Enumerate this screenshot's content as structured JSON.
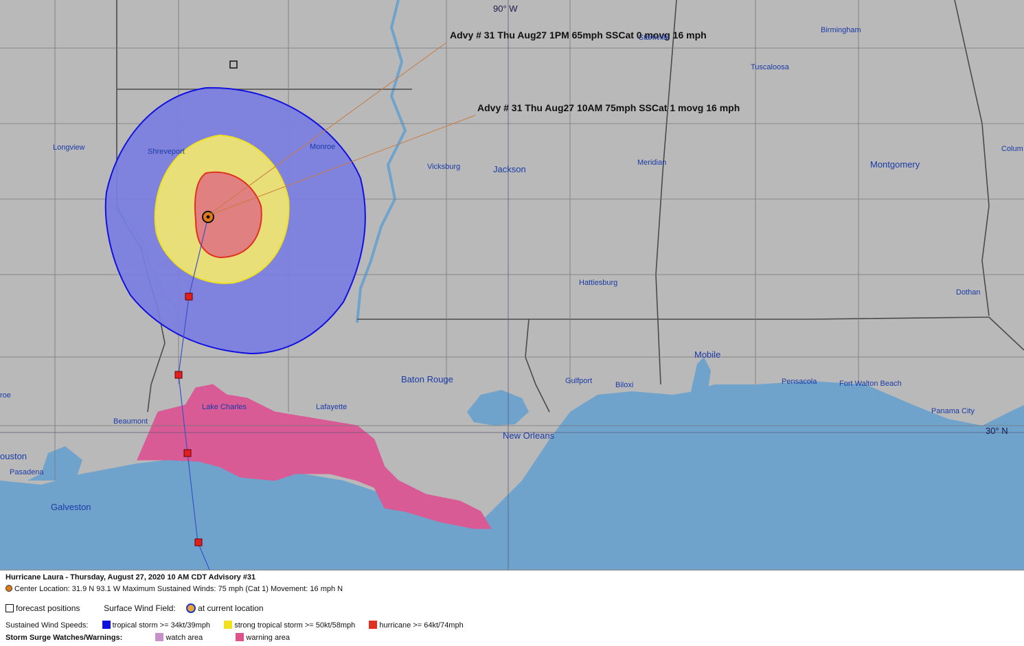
{
  "map": {
    "grid_labels": {
      "lon": "90° W",
      "lat": "30° N"
    },
    "cities": [
      {
        "name": "Birmingham",
        "size": "small"
      },
      {
        "name": "Starkville",
        "size": "small"
      },
      {
        "name": "Tuscaloosa",
        "size": "small"
      },
      {
        "name": "Longview",
        "size": "small"
      },
      {
        "name": "Shreveport",
        "size": "small"
      },
      {
        "name": "Monroe",
        "size": "small"
      },
      {
        "name": "Vicksburg",
        "size": "small"
      },
      {
        "name": "Jackson",
        "size": "large"
      },
      {
        "name": "Meridian",
        "size": "small"
      },
      {
        "name": "Montgomery",
        "size": "large"
      },
      {
        "name": "Colum",
        "size": "small"
      },
      {
        "name": "Hattiesburg",
        "size": "small"
      },
      {
        "name": "Dothan",
        "size": "small"
      },
      {
        "name": "Mobile",
        "size": "large"
      },
      {
        "name": "Baton Rouge",
        "size": "large"
      },
      {
        "name": "Gulfport",
        "size": "small"
      },
      {
        "name": "Biloxi",
        "size": "small"
      },
      {
        "name": "Pensacola",
        "size": "small"
      },
      {
        "name": "Fort Walton Beach",
        "size": "small"
      },
      {
        "name": "Panama City",
        "size": "small"
      },
      {
        "name": "Lake Charles",
        "size": "small"
      },
      {
        "name": "Lafayette",
        "size": "small"
      },
      {
        "name": "Beaumont",
        "size": "small"
      },
      {
        "name": "New Orleans",
        "size": "large"
      },
      {
        "name": "roe",
        "size": "small"
      },
      {
        "name": "ouston",
        "size": "large"
      },
      {
        "name": "Pasadena",
        "size": "small"
      },
      {
        "name": "Galveston",
        "size": "large"
      }
    ],
    "advisories": [
      "Advy # 31 Thu Aug27 1PM  65mph SSCat 0 movg 16 mph",
      "Advy # 31 Thu Aug27 10AM  75mph SSCat 1 movg 16 mph"
    ],
    "colors": {
      "land": "#b9b9b9",
      "water": "#6fa3cc",
      "borders": "#555555",
      "tropical_storm": "#2020e0",
      "strong_tropical_storm": "#f0e020",
      "hurricane": "#e03020",
      "storm_surge_warning": "#e0508a",
      "storm_surge_watch": "#c890c8",
      "track": "#3a50c8",
      "annotation_line": "#c87a40"
    }
  },
  "legend": {
    "title": "Hurricane Laura  -  Thursday, August 27, 2020  10 AM CDT   Advisory #31",
    "center_line": "Center Location: 31.9 N  93.1 W   Maximum Sustained Winds: 75 mph (Cat 1) Movement: 16 mph N",
    "forecast_positions": "forecast positions",
    "surface_wind_field": "Surface Wind Field:",
    "current_location": "at current location",
    "sustained_label": "Sustained Wind Speeds:",
    "wind_categories": [
      {
        "label": "tropical storm >= 34kt/39mph",
        "color": "#1010e0"
      },
      {
        "label": "strong tropical storm >= 50kt/58mph",
        "color": "#f0e020"
      },
      {
        "label": "hurricane >= 64kt/74mph",
        "color": "#e03020"
      }
    ],
    "surge_label": "Storm Surge Watches/Warnings:",
    "surge_categories": [
      {
        "label": "watch area",
        "color": "#c890c8"
      },
      {
        "label": "warning area",
        "color": "#e0508a"
      }
    ]
  }
}
